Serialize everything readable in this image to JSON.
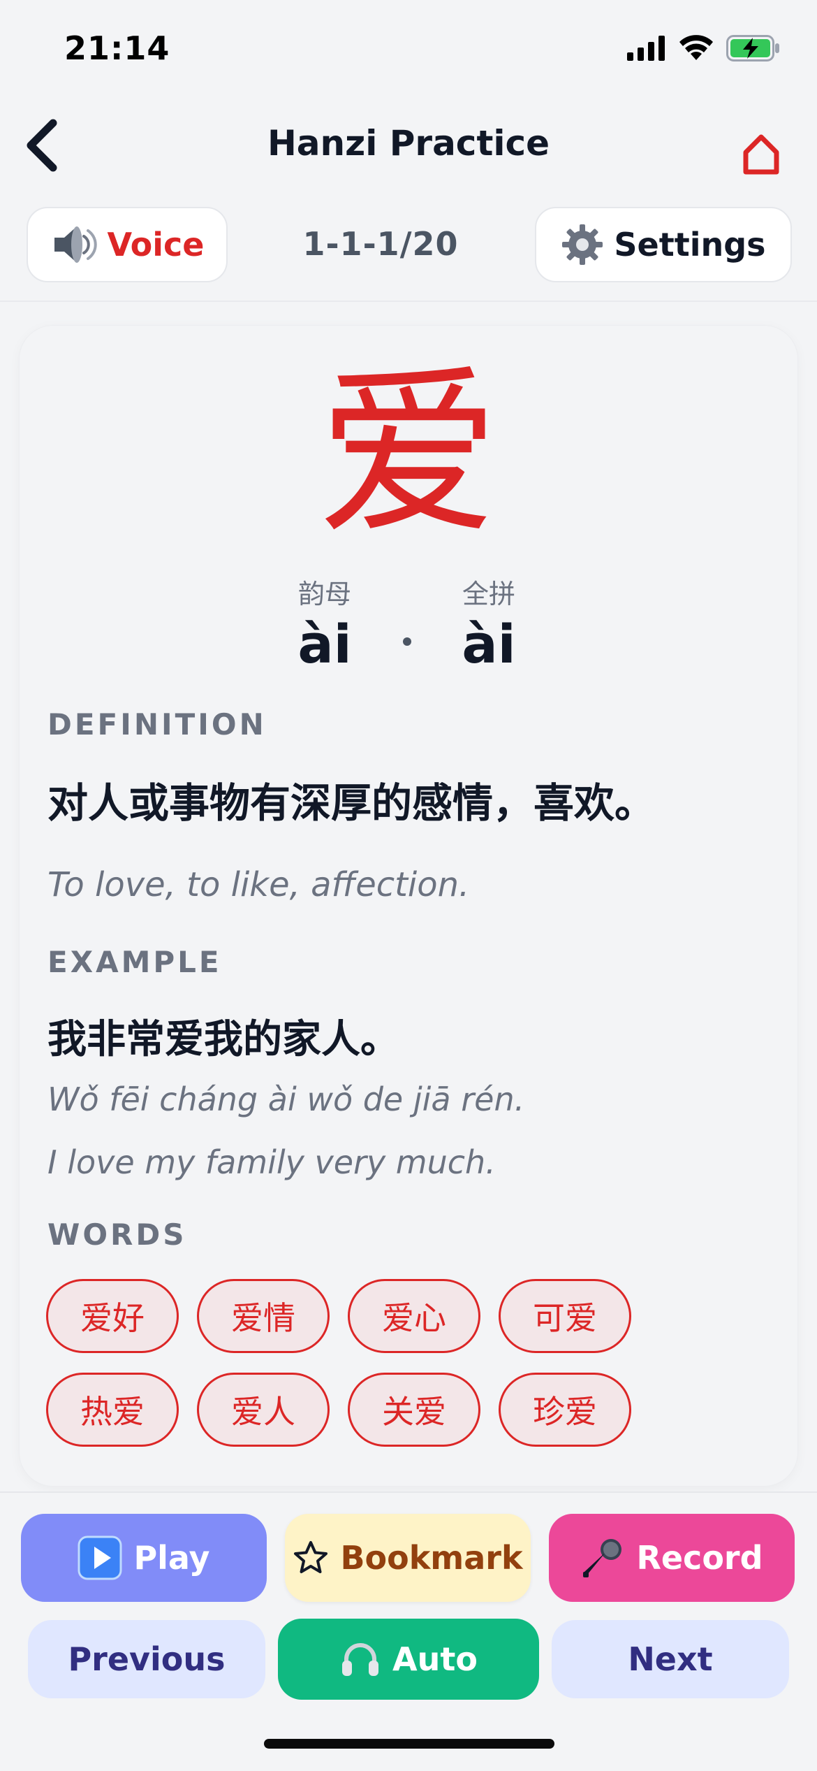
{
  "status_bar": {
    "time": "21:14"
  },
  "nav": {
    "title": "Hanzi Practice"
  },
  "toolbar": {
    "voice_label": "Voice",
    "progress": "1-1-1/20",
    "settings_label": "Settings"
  },
  "character": {
    "hanzi": "爱",
    "final_caption": "韵母",
    "final_value": "ài",
    "full_caption": "全拼",
    "full_value": "ài"
  },
  "definition": {
    "label": "DEFINITION",
    "zh": "对人或事物有深厚的感情，喜欢。",
    "en": "To love, to like, affection."
  },
  "example": {
    "label": "EXAMPLE",
    "zh": "我非常爱我的家人。",
    "pinyin": "Wǒ fēi cháng ài wǒ de jiā rén.",
    "en": "I love my family very much."
  },
  "words": {
    "label": "WORDS",
    "items": [
      "爱好",
      "爱情",
      "爱心",
      "可爱",
      "热爱",
      "爱人",
      "关爱",
      "珍爱"
    ]
  },
  "actions": {
    "play": "Play",
    "bookmark": "Bookmark",
    "record": "Record",
    "previous": "Previous",
    "auto": "Auto",
    "next": "Next"
  },
  "colors": {
    "accent_red": "#DC2626",
    "play": "#818CF8",
    "bookmark": "#FEF3C7",
    "record": "#EC4899",
    "auto": "#10B981",
    "nav_secondary": "#E0E7FF"
  },
  "icons": {
    "back": "chevron-left-icon",
    "home": "home-icon",
    "voice": "speaker-icon",
    "settings": "gear-icon",
    "play": "play-icon",
    "bookmark": "star-icon",
    "record": "microphone-icon",
    "auto": "headphones-icon"
  }
}
